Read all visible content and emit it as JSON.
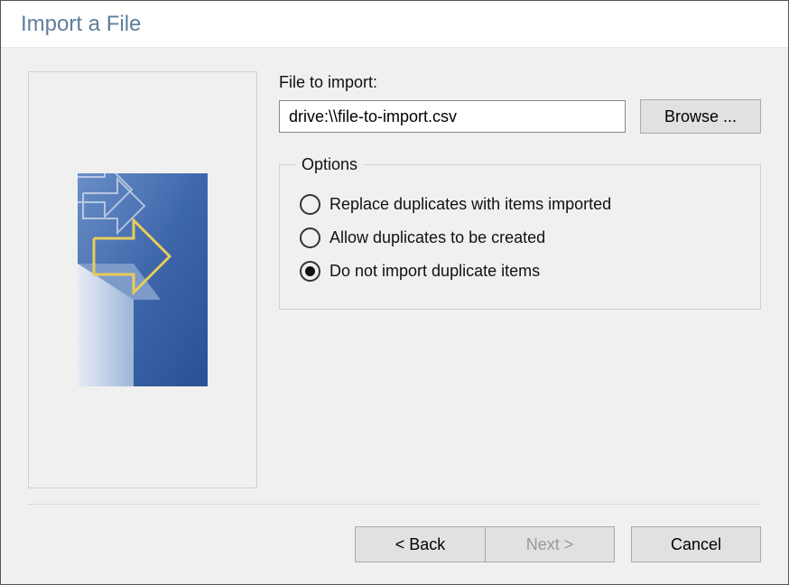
{
  "title": "Import a File",
  "file_label": "File to import:",
  "file_value": "drive:\\\\file-to-import.csv",
  "browse_label": "Browse ...",
  "options_legend": "Options",
  "options": [
    {
      "label": "Replace duplicates with items imported",
      "checked": false
    },
    {
      "label": "Allow duplicates to be created",
      "checked": false
    },
    {
      "label": "Do not import duplicate items",
      "checked": true
    }
  ],
  "buttons": {
    "back": "< Back",
    "next": "Next >",
    "cancel": "Cancel"
  },
  "next_enabled": false
}
